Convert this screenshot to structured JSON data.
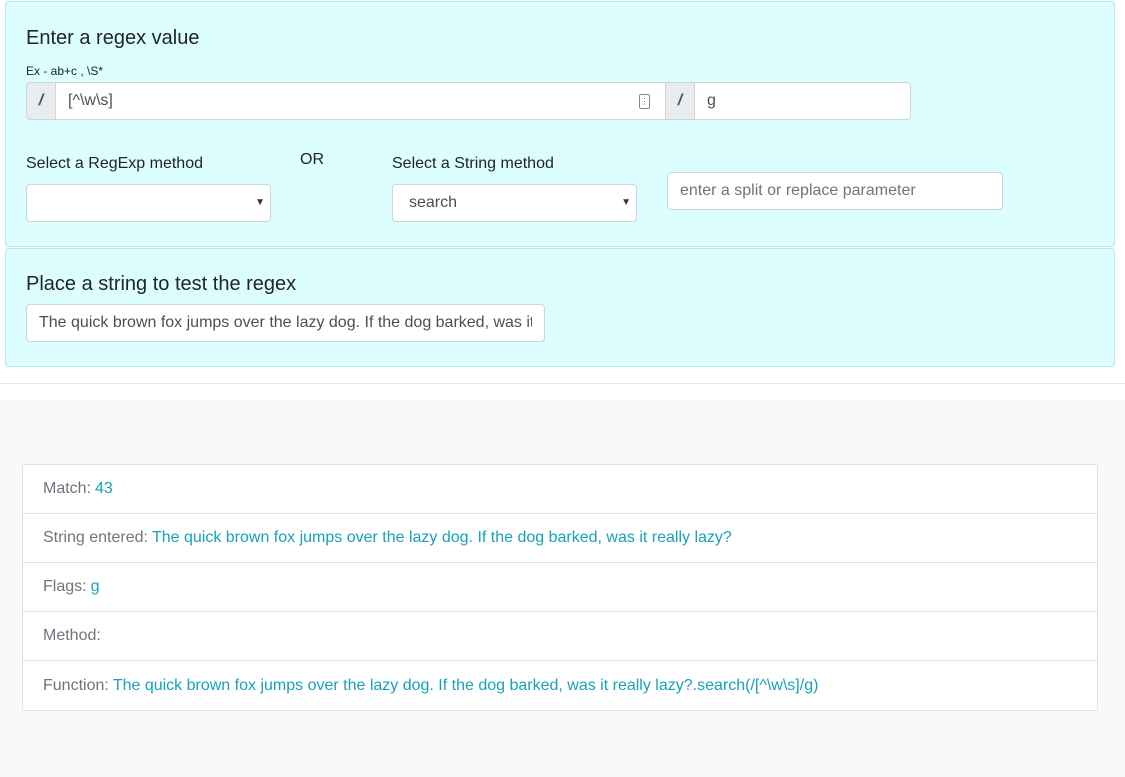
{
  "regex_panel": {
    "heading": "Enter a regex value",
    "hint": "Ex - ab+c , \\S*",
    "slash_left": "/",
    "slash_right": "/",
    "pattern_value": "[^\\w\\s]",
    "flags_value": "g",
    "regexp_method_label": "Select a RegExp method",
    "regexp_method_selected": "",
    "or_text": "OR",
    "string_method_label": "Select a String method",
    "string_method_selected": "search",
    "param_placeholder": "enter a split or replace parameter"
  },
  "test_panel": {
    "heading": "Place a string to test the regex",
    "string_value": "The quick brown fox jumps over the lazy dog. If the dog barked, was it really lazy?"
  },
  "results": [
    {
      "key": "Match:",
      "value": "43"
    },
    {
      "key": "String entered:",
      "value": "The quick brown fox jumps over the lazy dog. If the dog barked, was it really lazy?"
    },
    {
      "key": "Flags:",
      "value": "g"
    },
    {
      "key": "Method:",
      "value": ""
    },
    {
      "key": "Function:",
      "value": "The quick brown fox jumps over the lazy dog. If the dog barked, was it really lazy?.search(/[^\\w\\s]/g)"
    }
  ],
  "colors": {
    "panel_bg": "#dcfeff",
    "result_value": "#17a2b8",
    "result_key": "#6c757d"
  }
}
